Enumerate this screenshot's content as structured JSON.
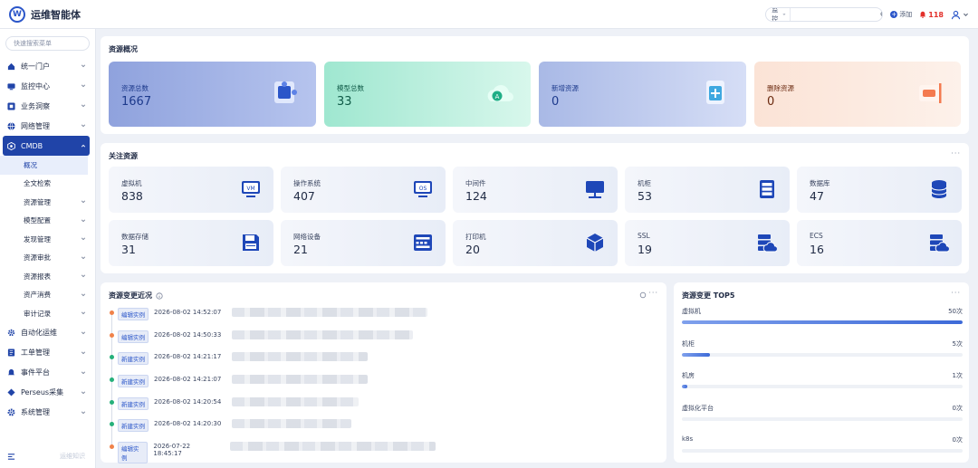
{
  "app": {
    "title": "运维智能体",
    "logo_letter": "W"
  },
  "topbar": {
    "search_select": "监控",
    "search_placeholder": "",
    "add_label": "添加",
    "alert_count": "118"
  },
  "sidebar": {
    "search_placeholder": "快速搜索菜单",
    "items": [
      {
        "label": "统一门户",
        "icon": "portal-icon"
      },
      {
        "label": "监控中心",
        "icon": "monitor-icon"
      },
      {
        "label": "业务洞察",
        "icon": "insight-icon"
      },
      {
        "label": "网络管理",
        "icon": "globe-icon"
      },
      {
        "label": "CMDB",
        "icon": "cmdb-icon",
        "active": true
      },
      {
        "label": "自动化运维",
        "icon": "gear-icon"
      },
      {
        "label": "工单管理",
        "icon": "ticket-icon"
      },
      {
        "label": "事件平台",
        "icon": "bell-icon"
      },
      {
        "label": "Perseus采集",
        "icon": "diamond-icon"
      },
      {
        "label": "系统管理",
        "icon": "settings-icon"
      }
    ],
    "cmdb_sub": [
      {
        "label": "概况",
        "active": true,
        "chevron": false
      },
      {
        "label": "全文检索",
        "chevron": false
      },
      {
        "label": "资源管理",
        "chevron": true
      },
      {
        "label": "模型配置",
        "chevron": true
      },
      {
        "label": "发现管理",
        "chevron": true
      },
      {
        "label": "资源审批",
        "chevron": true
      },
      {
        "label": "资源报表",
        "chevron": true
      },
      {
        "label": "资产消费",
        "chevron": true
      },
      {
        "label": "审计记录",
        "chevron": true
      }
    ],
    "footer_version": "运维知识"
  },
  "overview": {
    "title": "资源概况",
    "cards": [
      {
        "label": "资源总数",
        "value": "1667"
      },
      {
        "label": "模型总数",
        "value": "33"
      },
      {
        "label": "新增资源",
        "value": "0"
      },
      {
        "label": "删除资源",
        "value": "0"
      }
    ]
  },
  "focus": {
    "title": "关注资源",
    "more": "···",
    "cards": [
      {
        "label": "虚拟机",
        "value": "838",
        "icon": "vm-icon"
      },
      {
        "label": "操作系统",
        "value": "407",
        "icon": "os-icon"
      },
      {
        "label": "中间件",
        "value": "124",
        "icon": "middleware-icon"
      },
      {
        "label": "机柜",
        "value": "53",
        "icon": "cabinet-icon"
      },
      {
        "label": "数据库",
        "value": "47",
        "icon": "database-icon"
      },
      {
        "label": "数据存储",
        "value": "31",
        "icon": "floppy-icon"
      },
      {
        "label": "网络设备",
        "value": "21",
        "icon": "network-device-icon"
      },
      {
        "label": "打印机",
        "value": "20",
        "icon": "cube-icon"
      },
      {
        "label": "SSL",
        "value": "19",
        "icon": "cloud-server-icon"
      },
      {
        "label": "ECS",
        "value": "16",
        "icon": "cloud-server-icon"
      }
    ]
  },
  "changes": {
    "title": "资源变更近况",
    "more": "···",
    "rows": [
      {
        "tag": "编辑实例",
        "time": "2026-08-02 14:52:07",
        "color": "#f0824a",
        "w": 216
      },
      {
        "tag": "编辑实例",
        "time": "2026-08-02 14:50:33",
        "color": "#f0824a",
        "w": 200
      },
      {
        "tag": "新建实例",
        "time": "2026-08-02 14:21:17",
        "color": "#25b07a",
        "w": 150
      },
      {
        "tag": "新建实例",
        "time": "2026-08-02 14:21:07",
        "color": "#25b07a",
        "w": 150
      },
      {
        "tag": "新建实例",
        "time": "2026-08-02 14:20:54",
        "color": "#25b07a",
        "w": 140
      },
      {
        "tag": "新建实例",
        "time": "2026-08-02 14:20:30",
        "color": "#25b07a",
        "w": 132
      },
      {
        "tag": "编辑实例",
        "time": "2026-07-22 18:45:17",
        "color": "#f0824a",
        "w": 232
      }
    ]
  },
  "top5": {
    "title": "资源变更 TOP5",
    "more": "···",
    "items": [
      {
        "label": "虚拟机",
        "count": "50次",
        "pct": 100
      },
      {
        "label": "机柜",
        "count": "5次",
        "pct": 10
      },
      {
        "label": "机房",
        "count": "1次",
        "pct": 2
      },
      {
        "label": "虚拟化平台",
        "count": "0次",
        "pct": 0
      },
      {
        "label": "k8s",
        "count": "0次",
        "pct": 0
      }
    ]
  }
}
